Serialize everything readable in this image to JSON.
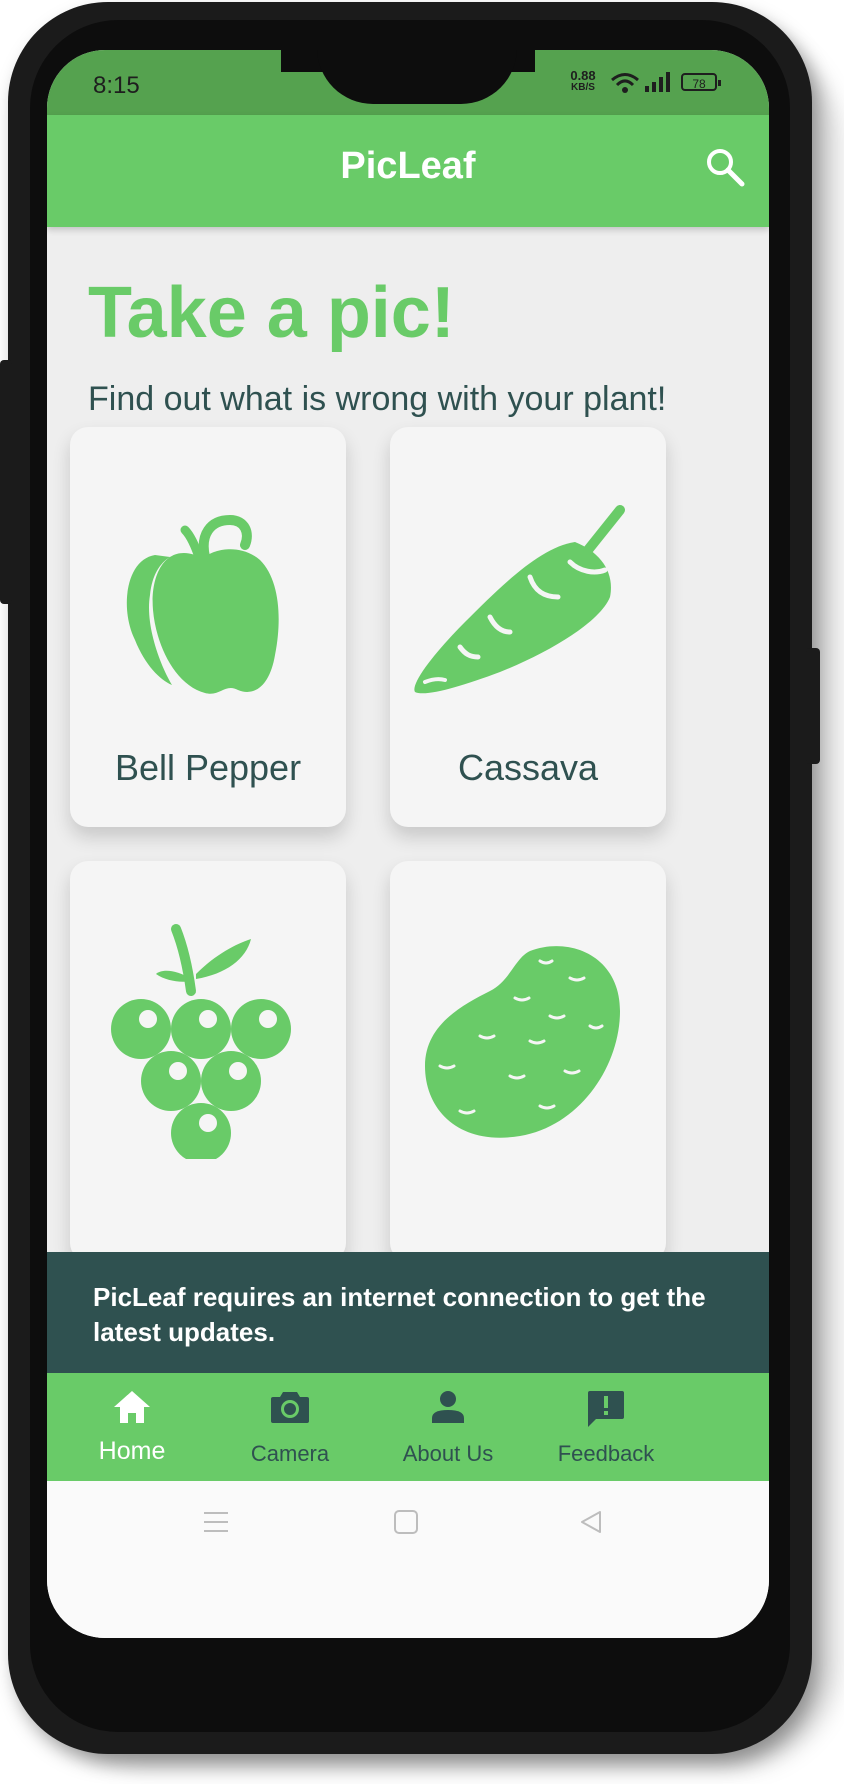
{
  "status_bar": {
    "time": "8:15",
    "speed_value": "0.88",
    "speed_unit": "KB/S",
    "battery": "78"
  },
  "app_bar": {
    "title": "PicLeaf",
    "search_icon": "search-icon"
  },
  "hero": {
    "headline": "Take a pic!",
    "subheadline": "Find out what is wrong with your plant!"
  },
  "plants": [
    {
      "label": "Bell Pepper",
      "icon": "bell-pepper-icon"
    },
    {
      "label": "Cassava",
      "icon": "cassava-icon"
    },
    {
      "label": "",
      "icon": "grape-icon"
    },
    {
      "label": "",
      "icon": "potato-icon"
    }
  ],
  "snackbar": {
    "message": "PicLeaf requires an internet connection to get the latest updates."
  },
  "bottom_nav": {
    "items": [
      {
        "label": "Home",
        "icon": "home-icon",
        "active": true
      },
      {
        "label": "Camera",
        "icon": "camera-icon"
      },
      {
        "label": "About Us",
        "icon": "person-icon"
      },
      {
        "label": "Feedback",
        "icon": "feedback-icon"
      }
    ]
  },
  "system_nav": [
    "menu-icon",
    "home-square-icon",
    "back-triangle-icon"
  ],
  "colors": {
    "primary_green": "#69cb68",
    "dark_teal": "#2f5150",
    "status_green": "#55a24f"
  }
}
